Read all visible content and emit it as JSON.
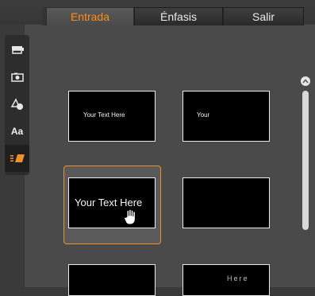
{
  "tabs": [
    {
      "label": "Entrada",
      "active": true
    },
    {
      "label": "Énfasis",
      "active": false
    },
    {
      "label": "Salir",
      "active": false
    }
  ],
  "sidebar": {
    "items": [
      {
        "icon": "title-clip-icon",
        "active": false
      },
      {
        "icon": "photo-icon",
        "active": false
      },
      {
        "icon": "shapes-icon",
        "active": false
      },
      {
        "icon": "text-style-icon",
        "label": "Aa",
        "active": false
      },
      {
        "icon": "animation-icon",
        "active": true
      }
    ]
  },
  "thumbnails": [
    {
      "text": "Your Text Here"
    },
    {
      "text": "Your"
    },
    {
      "text": "Your Text Here"
    },
    {
      "text": ""
    },
    {
      "text": ""
    },
    {
      "text": "Here"
    }
  ],
  "colors": {
    "accent": "#ff8c1a",
    "selection_border": "#f0902a"
  }
}
